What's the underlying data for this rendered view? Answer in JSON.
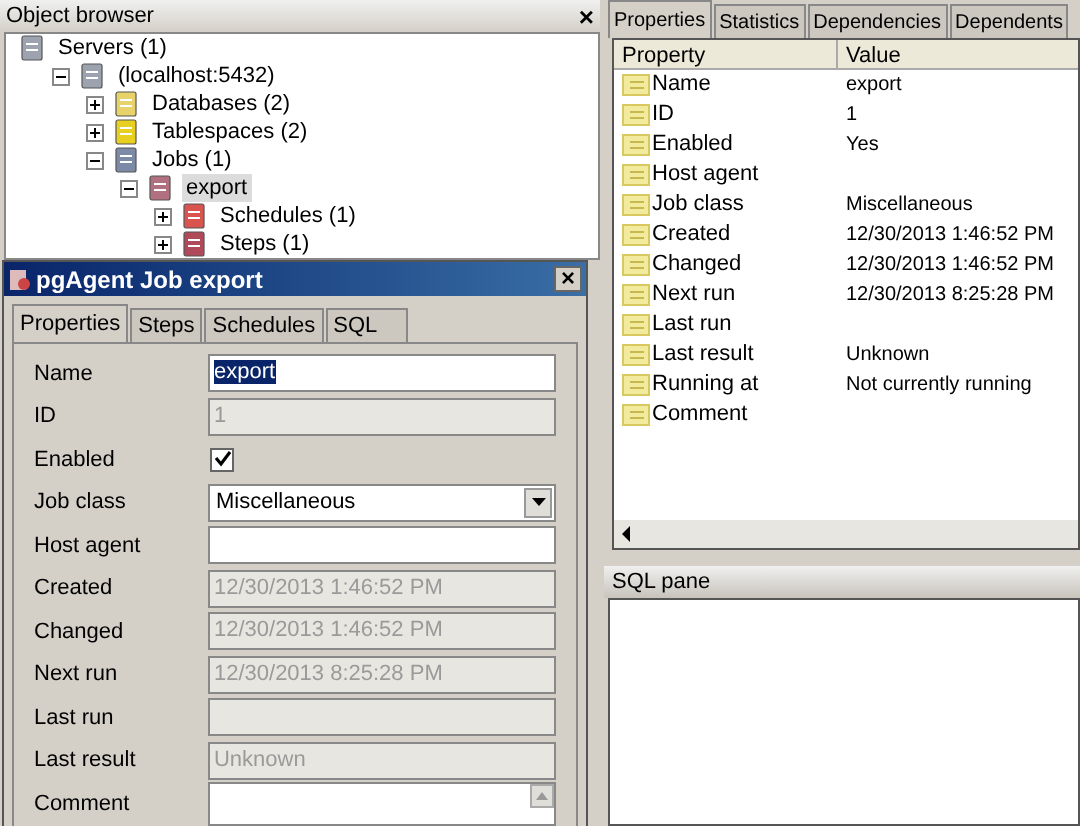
{
  "object_browser": {
    "title": "Object browser",
    "close": "×",
    "tree": [
      {
        "label": "Servers (1)",
        "selected": false,
        "children": [
          {
            "label": "(localhost:5432)",
            "expanded": true,
            "selected": false,
            "children": [
              {
                "label": "Databases (2)",
                "expanded": false,
                "selected": false
              },
              {
                "label": "Tablespaces (2)",
                "expanded": false,
                "selected": false
              },
              {
                "label": "Jobs (1)",
                "expanded": true,
                "selected": false,
                "children": [
                  {
                    "label": "export",
                    "expanded": true,
                    "selected": true,
                    "children": [
                      {
                        "label": "Schedules (1)",
                        "expanded": false,
                        "selected": false
                      },
                      {
                        "label": "Steps (1)",
                        "expanded": false,
                        "selected": false
                      }
                    ]
                  }
                ]
              }
            ]
          }
        ]
      }
    ]
  },
  "dialog": {
    "title": "pgAgent Job export",
    "close": "×",
    "tabs": [
      {
        "label": "Properties",
        "selected": true
      },
      {
        "label": "Steps",
        "selected": false
      },
      {
        "label": "Schedules",
        "selected": false
      },
      {
        "label": "SQL",
        "selected": false
      }
    ],
    "fields": [
      {
        "kind": "text",
        "label": "Name",
        "value": "export",
        "disabled": false,
        "highlighted": true
      },
      {
        "kind": "text",
        "label": "ID",
        "value": "1",
        "disabled": true
      },
      {
        "kind": "checkbox",
        "label": "Enabled",
        "checked": true
      },
      {
        "kind": "select",
        "label": "Job class",
        "value": "Miscellaneous"
      },
      {
        "kind": "text",
        "label": "Host agent",
        "disabled": false
      },
      {
        "kind": "text",
        "label": "Created",
        "value": "12/30/2013 1:46:52 PM",
        "disabled": true
      },
      {
        "kind": "text",
        "label": "Changed",
        "value": "12/30/2013 1:46:52 PM",
        "disabled": true
      },
      {
        "kind": "text",
        "label": "Next run",
        "value": "12/30/2013 8:25:28 PM",
        "disabled": true
      },
      {
        "kind": "text",
        "label": "Last run",
        "disabled": true
      },
      {
        "kind": "text",
        "label": "Last result",
        "value": "Unknown",
        "disabled": true
      },
      {
        "kind": "textarea",
        "label": "Comment"
      }
    ]
  },
  "properties_panel": {
    "tabs": [
      {
        "label": "Properties",
        "selected": true
      },
      {
        "label": "Statistics",
        "selected": false
      },
      {
        "label": "Dependencies",
        "selected": false
      },
      {
        "label": "Dependents",
        "selected": false
      }
    ],
    "columns": [
      "Property",
      "Value"
    ],
    "rows": [
      {
        "property": "Name",
        "value": "export"
      },
      {
        "property": "ID",
        "value": "1"
      },
      {
        "property": "Enabled",
        "value": "Yes"
      },
      {
        "property": "Host agent"
      },
      {
        "property": "Job class",
        "value": "Miscellaneous"
      },
      {
        "property": "Created",
        "value": "12/30/2013 1:46:52 PM"
      },
      {
        "property": "Changed",
        "value": "12/30/2013 1:46:52 PM"
      },
      {
        "property": "Next run",
        "value": "12/30/2013 8:25:28 PM"
      },
      {
        "property": "Last run"
      },
      {
        "property": "Last result",
        "value": "Unknown"
      },
      {
        "property": "Running at",
        "value": "Not currently running"
      },
      {
        "property": "Comment"
      }
    ]
  },
  "sql_pane": {
    "title": "SQL pane"
  }
}
